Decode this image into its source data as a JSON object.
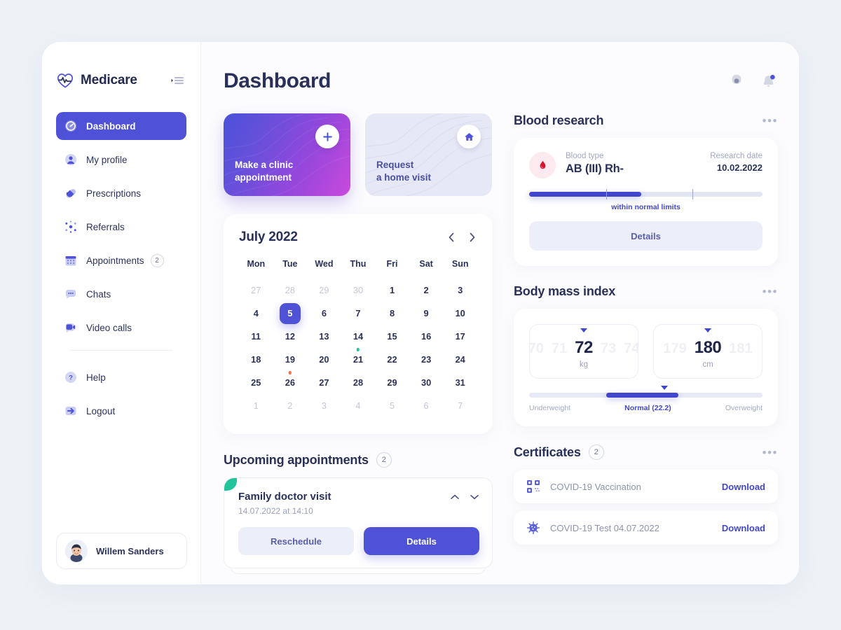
{
  "brand": {
    "name": "Medicare",
    "logo_icon": "heartbeat-icon",
    "collapse_icon": "collapse-sidebar-icon"
  },
  "sidebar": {
    "items": [
      {
        "label": "Dashboard",
        "icon": "dashboard-icon",
        "active": true,
        "badge": ""
      },
      {
        "label": "My profile",
        "icon": "user-icon",
        "active": false,
        "badge": ""
      },
      {
        "label": "Prescriptions",
        "icon": "pill-icon",
        "active": false,
        "badge": ""
      },
      {
        "label": "Referrals",
        "icon": "referrals-icon",
        "active": false,
        "badge": ""
      },
      {
        "label": "Appointments",
        "icon": "calendar-icon",
        "active": false,
        "badge": "2"
      },
      {
        "label": "Chats",
        "icon": "chat-icon",
        "active": false,
        "badge": ""
      },
      {
        "label": "Video calls",
        "icon": "video-camera-icon",
        "active": false,
        "badge": ""
      }
    ],
    "secondary_items": [
      {
        "label": "Help",
        "icon": "help-icon"
      },
      {
        "label": "Logout",
        "icon": "logout-icon"
      }
    ],
    "profile": {
      "name": "Willem Sanders",
      "avatar_icon": "avatar"
    }
  },
  "header": {
    "title": "Dashboard",
    "settings_icon": "gear-icon",
    "notifications_icon": "bell-icon",
    "has_notification": true
  },
  "action_cards": [
    {
      "label_line1": "Make a clinic",
      "label_line2": "appointment",
      "icon": "plus-icon",
      "style": "primary"
    },
    {
      "label_line1": "Request",
      "label_line2": "a home visit",
      "icon": "home-icon",
      "style": "secondary"
    }
  ],
  "calendar": {
    "title": "July 2022",
    "prev_icon": "chevron-left-icon",
    "next_icon": "chevron-right-icon",
    "weekdays": [
      "Mon",
      "Tue",
      "Wed",
      "Thu",
      "Fri",
      "Sat",
      "Sun"
    ],
    "weeks": [
      [
        {
          "d": "27",
          "muted": true
        },
        {
          "d": "28",
          "muted": true
        },
        {
          "d": "29",
          "muted": true
        },
        {
          "d": "30",
          "muted": true
        },
        {
          "d": "1"
        },
        {
          "d": "2"
        },
        {
          "d": "3"
        }
      ],
      [
        {
          "d": "4"
        },
        {
          "d": "5",
          "selected": true
        },
        {
          "d": "6"
        },
        {
          "d": "7"
        },
        {
          "d": "8"
        },
        {
          "d": "9"
        },
        {
          "d": "10"
        }
      ],
      [
        {
          "d": "11"
        },
        {
          "d": "12"
        },
        {
          "d": "13"
        },
        {
          "d": "14",
          "dot": "green"
        },
        {
          "d": "15"
        },
        {
          "d": "16"
        },
        {
          "d": "17"
        }
      ],
      [
        {
          "d": "18"
        },
        {
          "d": "19",
          "dot": "orange"
        },
        {
          "d": "20"
        },
        {
          "d": "21"
        },
        {
          "d": "22"
        },
        {
          "d": "23"
        },
        {
          "d": "24"
        }
      ],
      [
        {
          "d": "25"
        },
        {
          "d": "26"
        },
        {
          "d": "27"
        },
        {
          "d": "28"
        },
        {
          "d": "29"
        },
        {
          "d": "30"
        },
        {
          "d": "31"
        }
      ],
      [
        {
          "d": "1",
          "muted": true
        },
        {
          "d": "2",
          "muted": true
        },
        {
          "d": "3",
          "muted": true
        },
        {
          "d": "4",
          "muted": true
        },
        {
          "d": "5",
          "muted": true
        },
        {
          "d": "6",
          "muted": true
        },
        {
          "d": "7",
          "muted": true
        }
      ]
    ]
  },
  "upcoming": {
    "title": "Upcoming appointments",
    "count": "2",
    "appointment": {
      "title": "Family doctor visit",
      "datetime": "14.07.2022 at 14:10",
      "reschedule_label": "Reschedule",
      "details_label": "Details",
      "up_icon": "chevron-up-icon",
      "down_icon": "chevron-down-icon",
      "accent_color": "#23c39b"
    }
  },
  "blood_research": {
    "title": "Blood research",
    "more_icon": "more-dots-icon",
    "blood_icon": "blood-drop-icon",
    "type_label": "Blood type",
    "type_value": "AB (III) Rh-",
    "date_label": "Research date",
    "date_value": "10.02.2022",
    "bar_fill_percent": 48,
    "bar_tick_positions": [
      33,
      70
    ],
    "status_note": "within normal limits",
    "details_label": "Details",
    "accent_color": "#4246cc"
  },
  "bmi": {
    "title": "Body mass index",
    "more_icon": "more-dots-icon",
    "weight": {
      "value": "72",
      "unit": "kg",
      "ghost_left": [
        "70",
        "71"
      ],
      "ghost_right": [
        "73",
        "74"
      ]
    },
    "height": {
      "value": "180",
      "unit": "cm",
      "ghost_left": [
        "179"
      ],
      "ghost_right": [
        "181"
      ]
    },
    "scale": {
      "left_label": "Underweight",
      "center_label": "Normal (22.2)",
      "right_label": "Overweight",
      "normal_start_percent": 33,
      "normal_end_percent": 64,
      "marker_percent": 58
    }
  },
  "certificates": {
    "title": "Certificates",
    "count": "2",
    "more_icon": "more-dots-icon",
    "items": [
      {
        "name": "COVID-19 Vaccination",
        "icon": "qr-code-icon",
        "action": "Download"
      },
      {
        "name": "COVID-19 Test 04.07.2022",
        "icon": "virus-icon",
        "action": "Download"
      }
    ]
  },
  "colors": {
    "accent": "#4f52d6",
    "accent_dark": "#4246cc",
    "green": "#23c39b",
    "orange": "#f2714b",
    "page_bg": "#eef2f7",
    "text": "#2a3159",
    "muted": "#9aa0bb"
  }
}
